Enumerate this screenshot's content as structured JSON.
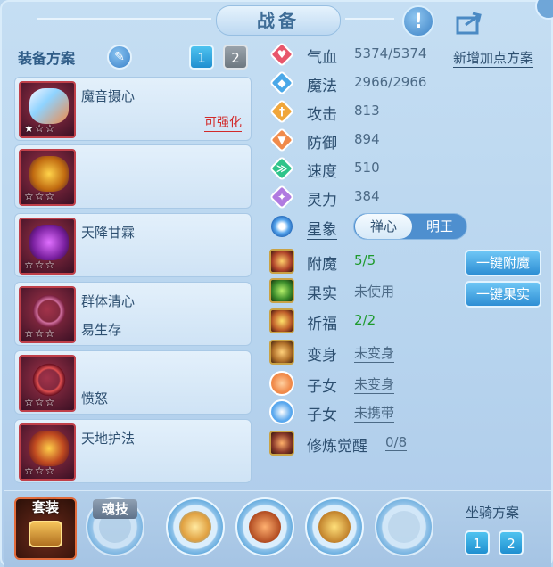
{
  "header": {
    "title": "战备",
    "help_icon": "exclamation-icon",
    "share_icon": "share-icon"
  },
  "left": {
    "scheme_label": "装备方案",
    "scheme_buttons": [
      "1",
      "2"
    ],
    "slots": [
      {
        "name": "魔音摄心",
        "extra": "",
        "stars": "★☆☆",
        "upgrade": "可强化",
        "icon_color": "#8fd3ff"
      },
      {
        "name": "",
        "extra": "",
        "stars": "☆☆☆",
        "upgrade": "",
        "icon_color": "#e0a12c"
      },
      {
        "name": "天降甘霖",
        "extra": "",
        "stars": "☆☆☆",
        "upgrade": "",
        "icon_color": "#b23fd1"
      },
      {
        "name": "群体清心",
        "extra": "易生存",
        "stars": "☆☆☆",
        "upgrade": "",
        "icon_color": "#c06080"
      },
      {
        "name": "",
        "extra": "愤怒",
        "stars": "☆☆☆",
        "upgrade": "",
        "icon_color": "#d04040"
      },
      {
        "name": "天地护法",
        "extra": "",
        "stars": "☆☆☆",
        "upgrade": "",
        "icon_color": "#d07a2a"
      }
    ]
  },
  "stats": [
    {
      "name": "气血",
      "value": "5374/5374",
      "color": "#e8566b",
      "glyph": "♥"
    },
    {
      "name": "魔法",
      "value": "2966/2966",
      "color": "#4aa8e8",
      "glyph": "◆"
    },
    {
      "name": "攻击",
      "value": "813",
      "color": "#f0a63a",
      "glyph": "†"
    },
    {
      "name": "防御",
      "value": "894",
      "color": "#f08a4a",
      "glyph": "▼"
    },
    {
      "name": "速度",
      "value": "510",
      "color": "#2fc48a",
      "glyph": "≫"
    },
    {
      "name": "灵力",
      "value": "384",
      "color": "#b07ae0",
      "glyph": "✦"
    }
  ],
  "add_scheme": "新增加点方案",
  "star_sign": {
    "label": "星象",
    "options": [
      "禅心",
      "明王"
    ],
    "selected": "禅心"
  },
  "features": [
    {
      "name": "附魔",
      "value": "5/5",
      "green": true,
      "link": false
    },
    {
      "name": "果实",
      "value": "未使用",
      "green": false,
      "link": false
    },
    {
      "name": "祈福",
      "value": "2/2",
      "green": true,
      "link": false
    },
    {
      "name": "变身",
      "value": "未变身",
      "green": false,
      "link": true
    },
    {
      "name": "子女",
      "value": "未变身",
      "green": false,
      "link": true
    },
    {
      "name": "子女",
      "value": "未携带",
      "green": false,
      "link": true
    },
    {
      "name": "修炼觉醒",
      "value": "0/8",
      "green": false,
      "link": true
    }
  ],
  "buttons": {
    "one_click_enchant": "一键附魔",
    "one_click_fruit": "一键果实"
  },
  "bottom": {
    "set_label": "套装",
    "soul_label": "魂技",
    "mount_label": "坐骑方案",
    "mount_buttons": [
      "1",
      "2"
    ]
  }
}
